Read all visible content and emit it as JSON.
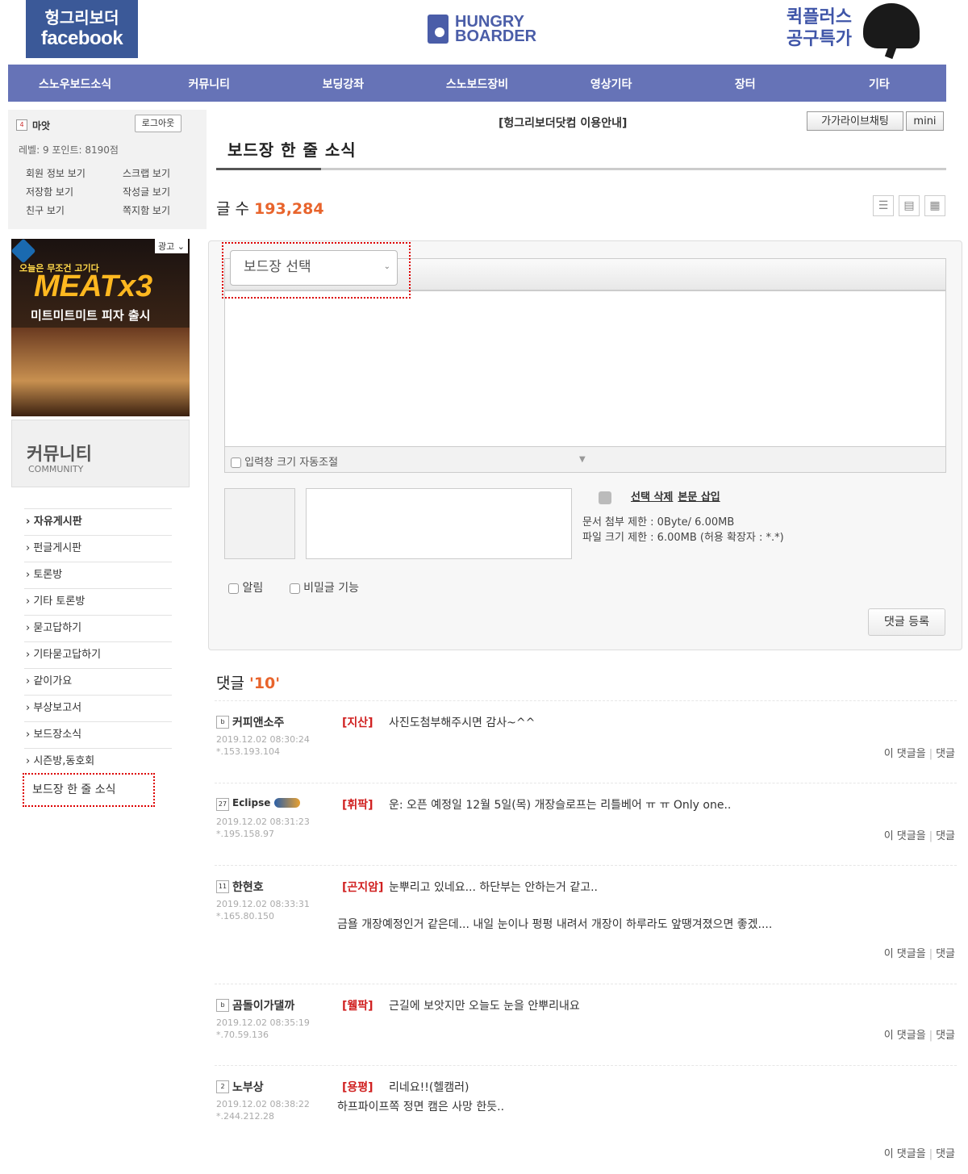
{
  "header": {
    "fb_line1": "헝그리보더",
    "fb_line2": "facebook",
    "logo_line1": "HUNGRY",
    "logo_line2": "BOARDER",
    "promo_line1": "퀵플러스",
    "promo_line2": "공구특가"
  },
  "nav": [
    "스노우보드소식",
    "커뮤니티",
    "보딩강좌",
    "스노보드장비",
    "영상기타",
    "장터",
    "기타"
  ],
  "user": {
    "name": "마앗",
    "logout": "로그아웃",
    "level": "레벨: 9  포인트: 8190점",
    "links": [
      "회원 정보 보기",
      "스크랩 보기",
      "저장함 보기",
      "작성글 보기",
      "친구 보기",
      "쪽지함 보기"
    ]
  },
  "ad": {
    "label": "광고",
    "sub": "오늘은 무조건 고기다",
    "big": "MEATx3",
    "desc": "미트미트미트 피자 출시"
  },
  "community": {
    "title": "커뮤니티",
    "sub": "COMMUNITY"
  },
  "menu": [
    "자유게시판",
    "펀글게시판",
    "토론방",
    "기타 토론방",
    "묻고답하기",
    "기타묻고답하기",
    "같이가요",
    "부상보고서",
    "보드장소식",
    "시즌방,동호회"
  ],
  "menu_current": "보드장 한 줄 소식",
  "main": {
    "notice": "[헝그리보더닷컴 이용안내]",
    "chat": "가가라이브채팅",
    "mini": "mini",
    "title": "보드장 한 줄 소식",
    "count_label": "글 수",
    "count": "193,284"
  },
  "editor": {
    "select_placeholder": "보드장 선택",
    "autosize": "입력창 크기 자동조절",
    "delete_selected": "선택 삭제",
    "insert_body": "본문 삽입",
    "attach_limit": "문서 첨부 제한 : 0Byte/ 6.00MB",
    "file_limit": "파일 크기 제한 : 6.00MB (허용 확장자 : *.*)",
    "notify": "알림",
    "secret": "비밀글 기능",
    "submit": "댓글 등록"
  },
  "comments": {
    "label": "댓글",
    "count": "'10'",
    "action_quote": "이 댓글을",
    "action_reply": "댓글",
    "items": [
      {
        "badge": "b",
        "author": "커피앤소주",
        "date": "2019.12.02 08:30:24",
        "ip": "*.153.193.104",
        "tag": "[지산]",
        "text": "사진도첨부해주시면 감사~^^",
        "text2": ""
      },
      {
        "badge": "27",
        "author": "Eclipse",
        "date": "2019.12.02 08:31:23",
        "ip": "*.195.158.97",
        "tag": "[휘팍]",
        "text": "운: 오픈 예정일 12월 5일(목) 개장슬로프는 리틀베어 ㅠ ㅠ Only one..",
        "text2": ""
      },
      {
        "badge": "11",
        "author": "한현호",
        "date": "2019.12.02 08:33:31",
        "ip": "*.165.80.150",
        "tag": "[곤지암]",
        "text": "눈뿌리고 있네요... 하단부는 안하는거 같고..",
        "text2": "금욜 개장예정인거 같은데... 내일 눈이나 펑펑 내려서 개장이 하루라도 앞땡겨졌으면 좋겠...."
      },
      {
        "badge": "b",
        "author": "곰돌이가댈까",
        "date": "2019.12.02 08:35:19",
        "ip": "*.70.59.136",
        "tag": "[웰팍]",
        "text": "근길에 보앗지만 오늘도 눈을 안뿌리내요",
        "text2": ""
      },
      {
        "badge": "2",
        "author": "노부상",
        "date": "2019.12.02 08:38:22",
        "ip": "*.244.212.28",
        "tag": "[용평]",
        "text": "리네요!!(헬캠러)",
        "text2": "하프파이프쪽 정면 캠은 사망 한듯.."
      }
    ]
  }
}
